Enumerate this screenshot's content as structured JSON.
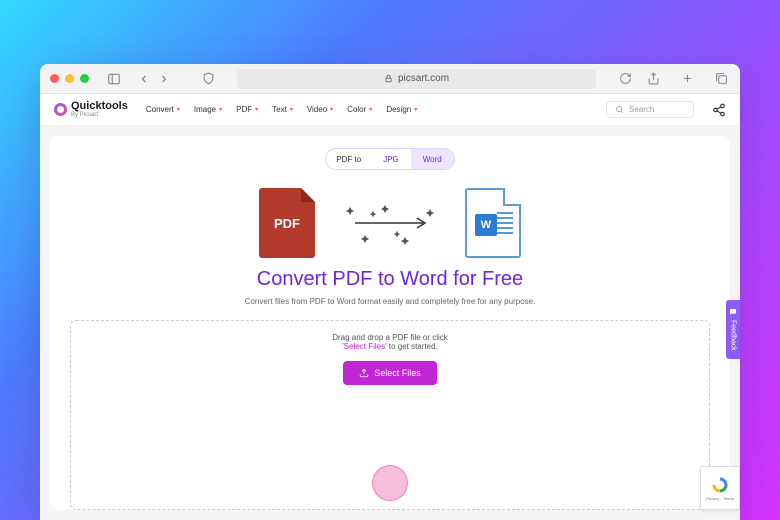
{
  "browser": {
    "domain": "picsart.com"
  },
  "header": {
    "logo": {
      "name": "Quicktools",
      "byline": "By Picsart"
    },
    "nav": [
      "Convert",
      "Image",
      "PDF",
      "Text",
      "Video",
      "Color",
      "Design"
    ],
    "search_placeholder": "Search"
  },
  "segment": {
    "label": "PDF to",
    "options": [
      "JPG",
      "Word"
    ],
    "active": "Word"
  },
  "illustration": {
    "pdf_label": "PDF",
    "word_label": "W"
  },
  "main": {
    "title": "Convert PDF to Word for Free",
    "subtitle": "Convert files from PDF to Word format easily and completely free for any purpose."
  },
  "dropzone": {
    "line1": "Drag and drop a PDF file or click",
    "highlight": "'Select Files'",
    "line2_suffix": " to get started.",
    "button": "Select Files"
  },
  "feedback_label": "Feedback",
  "recaptcha_label": "Privacy - Terms"
}
